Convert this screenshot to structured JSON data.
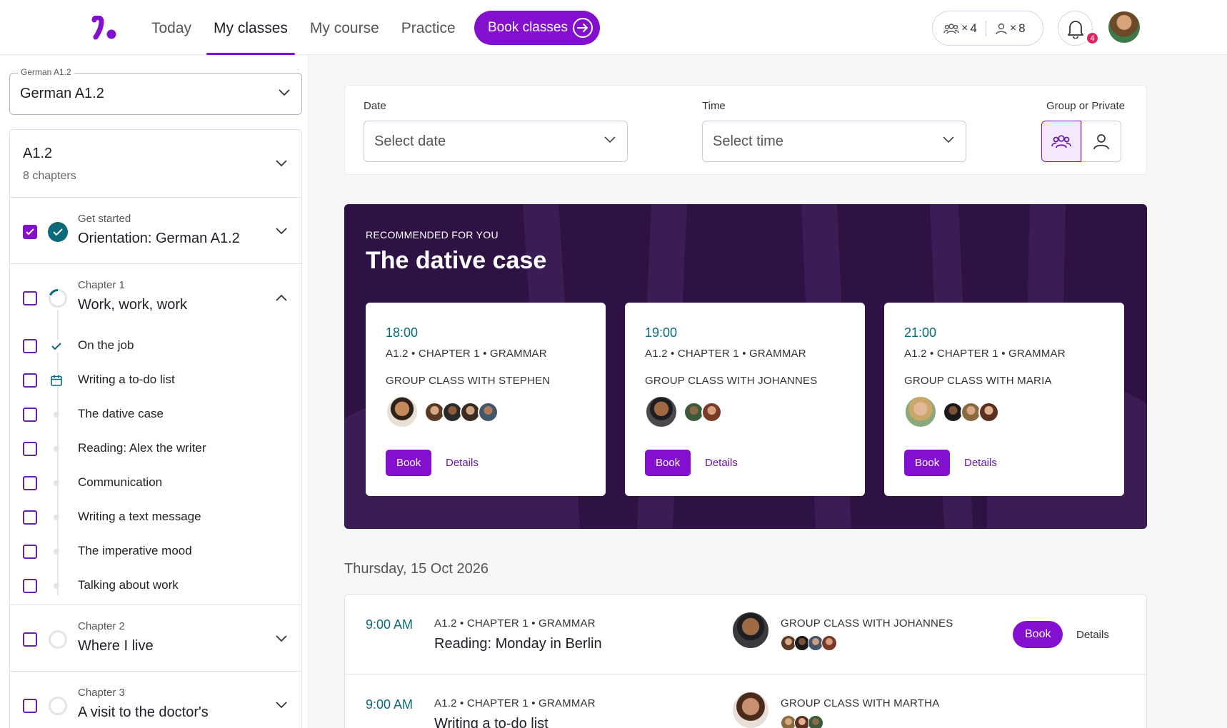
{
  "nav": {
    "items": [
      "Today",
      "My classes",
      "My course",
      "Practice"
    ],
    "active": "My classes",
    "book_cta": "Book classes"
  },
  "credits": {
    "group_count": "4",
    "private_count": "8",
    "x": "×"
  },
  "notifications": {
    "count": "4"
  },
  "sidebar": {
    "course_legend": "German A1.2",
    "course_value": "German A1.2",
    "level": {
      "title": "A1.2",
      "subtitle": "8 chapters"
    },
    "get_started": {
      "label": "Get started",
      "title": "Orientation: German A1.2"
    },
    "chapter1": {
      "label": "Chapter 1",
      "title": "Work, work, work",
      "lessons": [
        "On the job",
        "Writing a to-do list",
        "The dative case",
        "Reading: Alex the writer",
        "Communication",
        "Writing a text message",
        "The imperative mood",
        "Talking about work"
      ]
    },
    "chapter2": {
      "label": "Chapter 2",
      "title": "Where I live"
    },
    "chapter3": {
      "label": "Chapter 3",
      "title": "A visit to the doctor's"
    }
  },
  "filters": {
    "date_label": "Date",
    "date_placeholder": "Select date",
    "time_label": "Time",
    "time_placeholder": "Select time",
    "type_label": "Group or Private",
    "selected_type": "group"
  },
  "recommended": {
    "eyebrow": "RECOMMENDED FOR YOU",
    "title": "The dative case",
    "cards": [
      {
        "time": "18:00",
        "meta": "A1.2 • CHAPTER 1 • GRAMMAR",
        "teacher": "GROUP CLASS WITH STEPHEN",
        "book": "Book",
        "details": "Details"
      },
      {
        "time": "19:00",
        "meta": "A1.2 • CHAPTER 1 • GRAMMAR",
        "teacher": "GROUP CLASS WITH JOHANNES",
        "book": "Book",
        "details": "Details"
      },
      {
        "time": "21:00",
        "meta": "A1.2 • CHAPTER 1 • GRAMMAR",
        "teacher": "GROUP CLASS WITH MARIA",
        "book": "Book",
        "details": "Details"
      }
    ]
  },
  "day": {
    "heading": "Thursday, 15 Oct 2026",
    "rows": [
      {
        "time": "9:00 AM",
        "meta": "A1.2  •  CHAPTER 1  •  GRAMMAR",
        "title": "Reading: Monday in Berlin",
        "teacher": "GROUP CLASS WITH JOHANNES",
        "book": "Book",
        "details": "Details"
      },
      {
        "time": "9:00 AM",
        "meta": "A1.2  •  CHAPTER 1  •  GRAMMAR",
        "title": "Writing a to-do list",
        "teacher": "GROUP CLASS WITH MARTHA"
      }
    ]
  },
  "colors": {
    "brand": "#8410cf",
    "teal": "#0a6a7a",
    "banner": "#2e1244"
  }
}
